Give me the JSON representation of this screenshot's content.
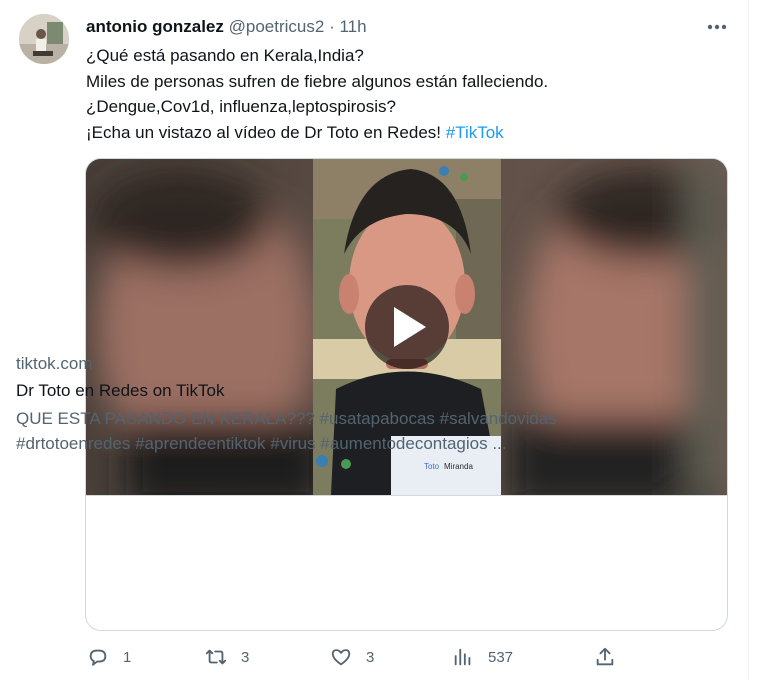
{
  "tweet": {
    "author_name": "antonio gonzalez",
    "handle": "@poetricus2",
    "separator": "·",
    "time": "11h",
    "lines": [
      "¿Qué está pasando en Kerala,India?",
      "Miles de personas sufren de fiebre algunos están falleciendo.",
      "¿Dengue,Cov1d, influenza,leptospirosis?"
    ],
    "last_line_text": "¡Echa un vistazo al vídeo de Dr Toto en Redes! ",
    "hashtag": "#TikTok"
  },
  "card": {
    "domain": "tiktok.com",
    "title": "Dr Toto en Redes on TikTok",
    "description_lines": [
      "QUE ESTA PASANDO EN KERALA??? #usatapabocas #salvandovidas",
      "#drtotoenredes #aprendeentiktok #virus #aumentodecontagios ..."
    ],
    "video_overlay_first": "Toto",
    "video_overlay_second": "Miranda"
  },
  "actions": {
    "reply_count": "1",
    "retweet_count": "3",
    "like_count": "3",
    "views_count": "537"
  },
  "icons": [
    "more-icon",
    "reply-icon",
    "retweet-icon",
    "like-icon",
    "views-icon",
    "share-icon",
    "play-icon"
  ],
  "colors": {
    "link": "#1d9bf0",
    "secondary": "#536471",
    "text": "#0f1419",
    "border": "#cfd9de"
  }
}
